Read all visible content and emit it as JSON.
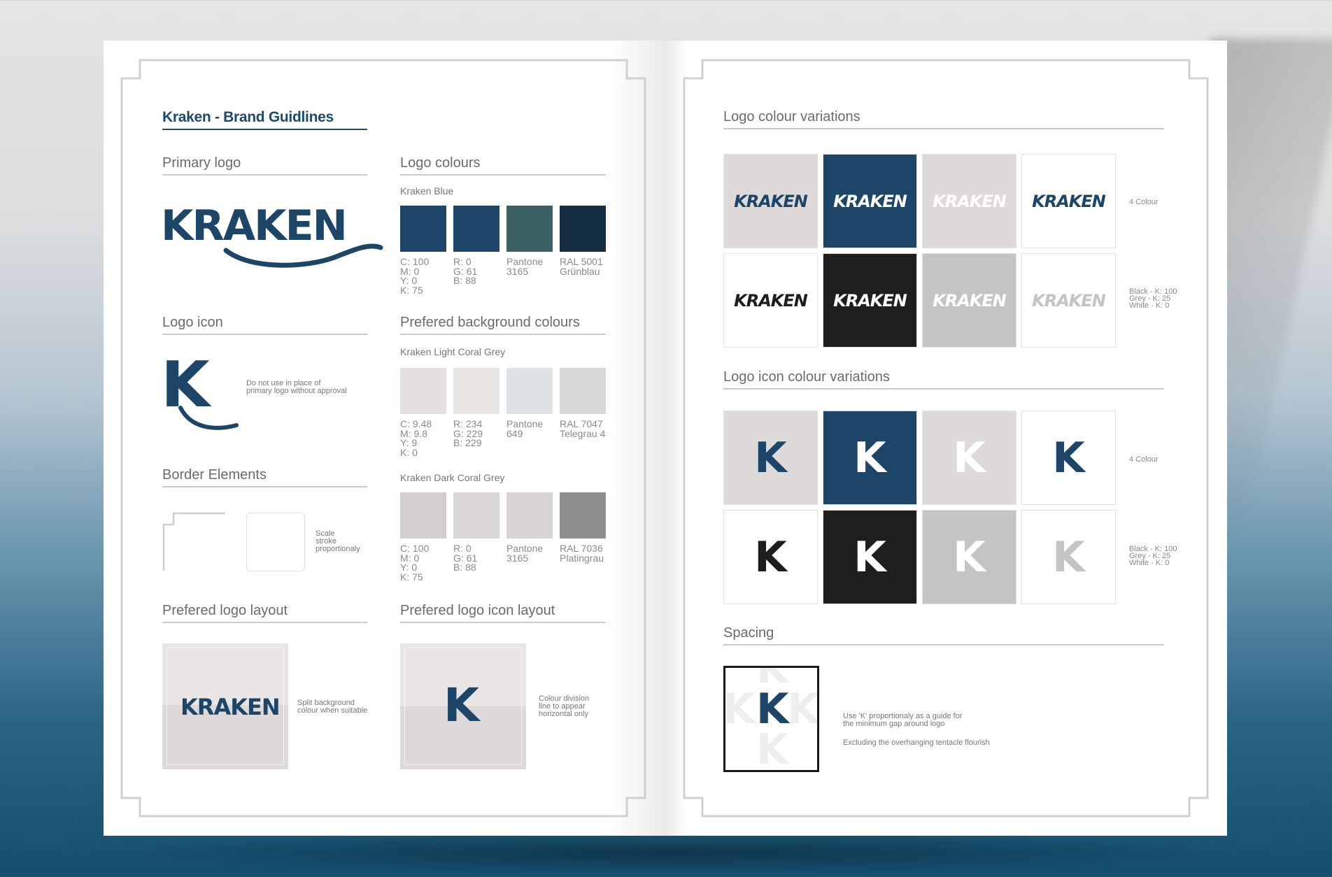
{
  "left_page": {
    "title": "Kraken - Brand Guidlines",
    "primary_logo": {
      "heading": "Primary logo",
      "logo_text": "KRAKEN"
    },
    "logo_icon": {
      "heading": "Logo icon",
      "icon_text": "K",
      "note": [
        "Do not use in place of",
        "primary logo without approval"
      ]
    },
    "border_elements": {
      "heading": "Border Elements",
      "note": [
        "Scale",
        "stroke",
        "proportionaly"
      ]
    },
    "logo_colours": {
      "heading": "Logo colours",
      "subheading": "Kraken Blue",
      "swatches": [
        "#1c4567",
        "#1c4567",
        "#3c6164",
        "#162e42"
      ],
      "specs": [
        [
          "C: 100",
          "M: 0",
          "Y: 0",
          "K: 75"
        ],
        [
          "R: 0",
          "G: 61",
          "B: 88"
        ],
        [
          "Pantone",
          "3165"
        ],
        [
          "RAL 5001",
          "Grünblau"
        ]
      ]
    },
    "background_colours": {
      "heading": "Prefered background colours",
      "light": {
        "subheading": "Kraken Light Coral Grey",
        "swatches": [
          "#e4e1e0",
          "#e9e5e3",
          "#dde3e7",
          "#d8d8d6"
        ],
        "specs": [
          [
            "C: 9.48",
            "M: 9.8",
            "Y: 9",
            "K: 0"
          ],
          [
            "R: 234",
            "G: 229",
            "B: 229"
          ],
          [
            "Pantone",
            "649"
          ],
          [
            "RAL 7047",
            "Telegrau 4"
          ]
        ]
      },
      "dark": {
        "subheading": "Kraken Dark Coral Grey",
        "swatches": [
          "#d2cfce",
          "#d9d6d5",
          "#d7d4d3",
          "#8f8f8f"
        ],
        "specs": [
          [
            "C: 100",
            "M: 0",
            "Y: 0",
            "K: 75"
          ],
          [
            "R: 0",
            "G: 61",
            "B: 88"
          ],
          [
            "Pantone",
            "3165"
          ],
          [
            "RAL 7036",
            "Platingrau"
          ]
        ]
      }
    },
    "logo_layout": {
      "heading": "Prefered logo layout",
      "logo_text": "KRAKEN",
      "note": [
        "Split background",
        "colour when suitable"
      ]
    },
    "icon_layout": {
      "heading": "Prefered logo icon layout",
      "icon_text": "K",
      "note": [
        "Colour division",
        "line to appear",
        "horizontal only"
      ]
    }
  },
  "right_page": {
    "logo_variations": {
      "heading": "Logo colour variations",
      "logo_text": "KRAKEN",
      "row1_label": [
        "4 Colour"
      ],
      "row2_label": [
        "Black - K: 100",
        "Grey - K: 25",
        "White - K: 0"
      ],
      "row1": [
        {
          "bg": "#dedad9",
          "fg": "#1c4567"
        },
        {
          "bg": "#1c4567",
          "fg": "#ffffff"
        },
        {
          "bg": "#dedad9",
          "fg": "#ffffff"
        },
        {
          "bg": "#ffffff",
          "fg": "#1c4567"
        }
      ],
      "row2": [
        {
          "bg": "#ffffff",
          "fg": "#1e1e1e"
        },
        {
          "bg": "#1e1e1e",
          "fg": "#ffffff"
        },
        {
          "bg": "#c4c4c4",
          "fg": "#ffffff"
        },
        {
          "bg": "#ffffff",
          "fg": "#c4c4c4"
        }
      ]
    },
    "icon_variations": {
      "heading": "Logo icon colour variations",
      "icon_text": "K",
      "row1_label": [
        "4 Colour"
      ],
      "row2_label": [
        "Black - K: 100",
        "Grey - K: 25",
        "White - K: 0"
      ],
      "row1": [
        {
          "bg": "#dedad9",
          "fg": "#1c4567"
        },
        {
          "bg": "#1c4567",
          "fg": "#ffffff"
        },
        {
          "bg": "#dedad9",
          "fg": "#ffffff"
        },
        {
          "bg": "#ffffff",
          "fg": "#1c4567"
        }
      ],
      "row2": [
        {
          "bg": "#ffffff",
          "fg": "#1e1e1e"
        },
        {
          "bg": "#1e1e1e",
          "fg": "#ffffff"
        },
        {
          "bg": "#c4c4c4",
          "fg": "#ffffff"
        },
        {
          "bg": "#ffffff",
          "fg": "#c4c4c4"
        }
      ]
    },
    "spacing": {
      "heading": "Spacing",
      "icon_text": "K",
      "note1": [
        "Use 'K' proportionaly as a guide for",
        "the minimum gap around logo"
      ],
      "note2": "Excluding the overhanging tentacle flourish"
    }
  },
  "colors": {
    "brand_blue": "#1c4567",
    "heading_grey": "#6b6b6b",
    "rule_grey": "#c9c9c9"
  }
}
